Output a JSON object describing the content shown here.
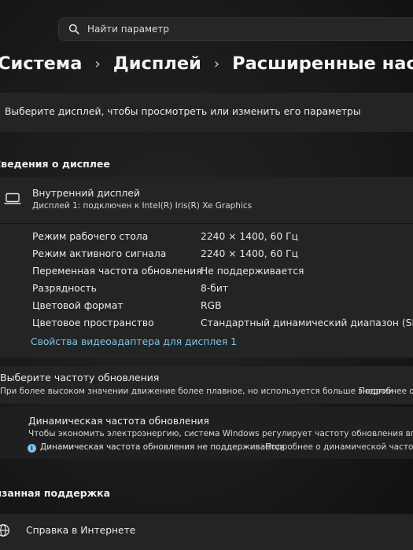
{
  "search": {
    "placeholder": "Найти параметр",
    "icon": "search-icon"
  },
  "breadcrumb": [
    "Система",
    "Дисплей",
    "Расширенные настройки"
  ],
  "select_display": {
    "label": "Выберите дисплей, чтобы просмотреть или изменить его параметры"
  },
  "display_info": {
    "title": "Сведения о дисплее",
    "device_name": "Внутренний дисплей",
    "device_sub": "Дисплей 1: подключен к Intel(R) Iris(R) Xe Graphics",
    "rows": [
      {
        "label": "Режим рабочего стола",
        "value": "2240 × 1400, 60 Гц"
      },
      {
        "label": "Режим активного сигнала",
        "value": "2240 × 1400, 60 Гц"
      },
      {
        "label": "Переменная частота обновления",
        "value": "Не поддерживается"
      },
      {
        "label": "Разрядность",
        "value": "8-бит"
      },
      {
        "label": "Цветовой формат",
        "value": "RGB"
      },
      {
        "label": "Цветовое пространство",
        "value": "Стандартный динамический диапазон (SDR)"
      }
    ],
    "adapter_link": "Свойства видеоадаптера для дисплея 1"
  },
  "refresh": {
    "title": "Выберите частоту обновления",
    "desc": "При более высоком значении движение более плавное, но используется больше энергии",
    "more_link": "Подробнее о",
    "dynamic_title": "Динамическая частота обновления",
    "dynamic_desc": "Чтобы экономить электроэнергию, система Windows регулирует частоту обновления вплоть до в",
    "not_supported": "Динамическая частота обновления не поддерживается",
    "dynamic_link": "Подробнее о динамической частоте о"
  },
  "support": {
    "title": "Связанная поддержка",
    "help_item": "Справка в Интернете"
  },
  "colors": {
    "accent": "#7fc5e8",
    "background": "#1a1a1a",
    "card": "#232424"
  }
}
